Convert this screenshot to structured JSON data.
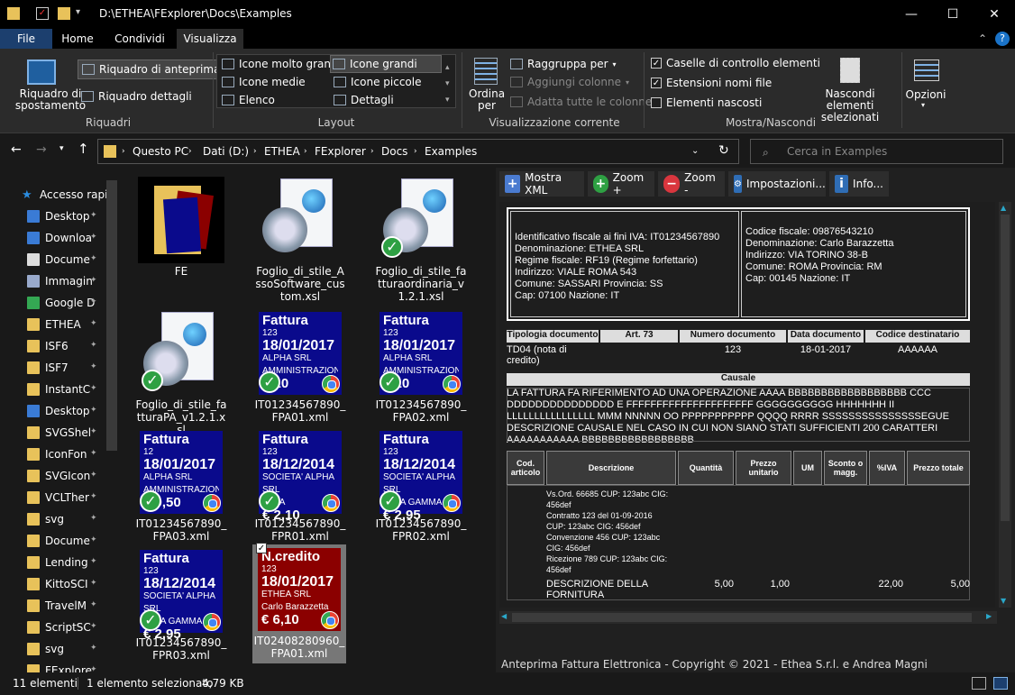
{
  "window": {
    "title": "D:\\ETHEA\\FExplorer\\Docs\\Examples",
    "minimize": "—",
    "maximize": "☐",
    "close": "✕"
  },
  "menu": {
    "tabs": [
      "File",
      "Home",
      "Condividi",
      "Visualizza"
    ],
    "help": "?"
  },
  "ribbon": {
    "riquadri": {
      "nav_pane": "Riquadro di spostamento",
      "preview": "Riquadro di anteprima",
      "details": "Riquadro dettagli",
      "group": "Riquadri"
    },
    "layout": {
      "items": [
        "Icone molto grandi",
        "Icone grandi",
        "Icone medie",
        "Icone piccole",
        "Elenco",
        "Dettagli"
      ],
      "group": "Layout"
    },
    "current_view": {
      "sort": "Ordina per",
      "group_by": "Raggruppa per",
      "add_cols": "Aggiungi colonne",
      "fit_cols": "Adatta tutte le colonne",
      "group": "Visualizzazione corrente"
    },
    "show_hide": {
      "checkboxes": "Caselle di controllo elementi",
      "extensions": "Estensioni nomi file",
      "hidden": "Elementi nascosti",
      "hide_selected": "Nascondi elementi selezionati",
      "group": "Mostra/Nascondi"
    },
    "options": "Opzioni"
  },
  "address": {
    "crumbs": [
      "Questo PC",
      "Dati (D:)",
      "ETHEA",
      "FExplorer",
      "Docs",
      "Examples"
    ],
    "search_placeholder": "Cerca in Examples"
  },
  "sidebar": {
    "items": [
      "Accesso rapi",
      "Desktop",
      "Downloa",
      "Docume",
      "Immagin",
      "Google D",
      "ETHEA",
      "ISF6",
      "ISF7",
      "InstantC",
      "Desktop",
      "SVGShel",
      "IconFon",
      "SVGIcon",
      "VCLTher",
      "svg",
      "Docume",
      "Lending",
      "KittoSCI",
      "TravelM",
      "ScriptSC",
      "svg",
      "FExplore"
    ]
  },
  "files": [
    {
      "name": "FE"
    },
    {
      "name": "Foglio_di_stile_AssoSoftware_custom.xsl"
    },
    {
      "name": "Foglio_di_stile_fatturaordinaria_v1.2.1.xsl"
    },
    {
      "name": "Foglio_di_stile_fatturaPA_v1.2.1.xsl"
    },
    {
      "name": "IT01234567890_FPA01.xml",
      "title": "Fattura",
      "num": "123",
      "date": "18/01/2017",
      "l1": "ALPHA SRL",
      "l2": "AMMINISTRAZIONE",
      "amt": "€ 10"
    },
    {
      "name": "IT01234567890_FPA02.xml",
      "title": "Fattura",
      "num": "123",
      "date": "18/01/2017",
      "l1": "ALPHA SRL",
      "l2": "AMMINISTRAZIONE",
      "amt": "€ 10"
    },
    {
      "name": "IT01234567890_FPA03.xml",
      "title": "Fattura",
      "num": "12",
      "date": "18/01/2017",
      "l1": "ALPHA SRL",
      "l2": "AMMINISTRAZIONE",
      "amt": "€ 0,50"
    },
    {
      "name": "IT01234567890_FPR01.xml",
      "title": "Fattura",
      "num": "123",
      "date": "18/12/2014",
      "l1": "SOCIETA' ALPHA SRL",
      "l2": "BETA",
      "amt": "€ 2,10"
    },
    {
      "name": "IT01234567890_FPR02.xml",
      "title": "Fattura",
      "num": "123",
      "date": "18/12/2014",
      "l1": "SOCIETA' ALPHA SRL",
      "l2": "BETA GAMMA",
      "amt": "€ 2,95"
    },
    {
      "name": "IT01234567890_FPR03.xml",
      "title": "Fattura",
      "num": "123",
      "date": "18/12/2014",
      "l1": "SOCIETA' ALPHA SRL",
      "l2": "BETA GAMMA",
      "amt": "€ 2,95"
    },
    {
      "name": "IT02408280960_FPA01.xml",
      "title": "N.credito",
      "num": "123",
      "date": "18/01/2017",
      "l1": "ETHEA SRL",
      "l2": "Carlo Barazzetta",
      "amt": "€ 6,10"
    }
  ],
  "preview_toolbar": [
    "Mostra XML",
    "Zoom +",
    "Zoom -",
    "Impostazioni...",
    "Info..."
  ],
  "invoice": {
    "seller": [
      "Identificativo fiscale ai fini IVA: IT01234567890",
      "Denominazione: ETHEA SRL",
      "Regime fiscale: RF19 (Regime forfettario)",
      "Indirizzo: VIALE ROMA 543",
      "Comune: SASSARI Provincia: SS",
      "Cap: 07100 Nazione: IT"
    ],
    "buyer": [
      "Codice fiscale: 09876543210",
      "Denominazione: Carlo Barazzetta",
      "Indirizzo: VIA TORINO 38-B",
      "Comune: ROMA Provincia: RM",
      "Cap: 00145 Nazione: IT"
    ],
    "doc_headers": [
      "Tipologia documento",
      "Art. 73",
      "Numero documento",
      "Data documento",
      "Codice destinatario"
    ],
    "doc_values": [
      "TD04 (nota di credito)",
      "",
      "123",
      "18-01-2017",
      "AAAAAA"
    ],
    "causale_header": "Causale",
    "causale": "LA FATTURA FA RIFERIMENTO AD UNA OPERAZIONE AAAA BBBBBBBBBBBBBBBBBB CCC DDDDDDDDDDDDDDD E FFFFFFFFFFFFFFFFFFFFF GGGGGGGGGG HHHHHHH II LLLLLLLLLLLLLLLL MMM NNNNN OO PPPPPPPPPPP QQQQ RRRR SSSSSSSSSSSSSSSEGUE DESCRIZIONE CAUSALE NEL CASO IN CUI NON SIANO STATI SUFFICIENTI 200 CARATTERI AAAAAAAAAAA BBBBBBBBBBBBBBBBB",
    "line_headers": [
      "Cod. articolo",
      "Descrizione",
      "Quantità",
      "Prezzo unitario",
      "UM",
      "Sconto o magg.",
      "%IVA",
      "Prezzo totale"
    ],
    "line_notes": [
      "Vs.Ord. 66685 CUP: 123abc CIG: 456def",
      "Contratto 123 del 01-09-2016 CUP: 123abc CIG: 456def",
      "Convenzione 456 CUP: 123abc CIG: 456def",
      "Ricezione 789 CUP: 123abc CIG: 456def"
    ],
    "line_desc": "DESCRIZIONE DELLA FORNITURA",
    "line_qty": "5,00",
    "line_price": "1,00",
    "line_vat": "22,00",
    "line_total": "5,00"
  },
  "preview_footer": "Anteprima Fattura Elettronica - Copyright © 2021 - Ethea S.r.l. e Andrea Magni",
  "status": {
    "count": "11 elementi",
    "selected": "1 elemento selezionato",
    "size": "4,79 KB"
  },
  "colors": {
    "invoice_blue": "#0a0a8c",
    "credit_red": "#8b0000",
    "accent": "#0078d7"
  }
}
